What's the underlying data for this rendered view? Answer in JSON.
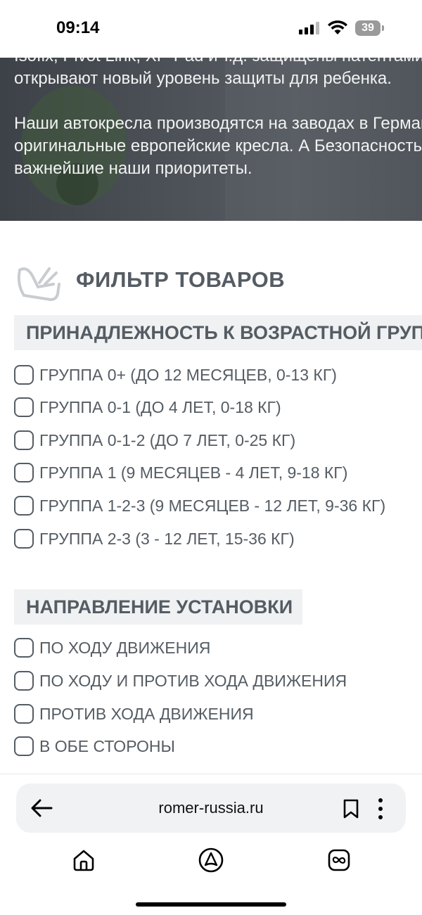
{
  "status_bar": {
    "time": "09:14",
    "battery": "39"
  },
  "hero": {
    "lines": [
      "Isofix, Pivot Link, XP-Pad и т.д. защищены патентами",
      "открывают новый уровень защиты для ребенка.",
      "",
      "Наши автокресла производятся на заводах в Германии",
      "оригинальные европейские кресла. А Безопасность",
      "важнейшие наши приоритеты."
    ]
  },
  "filter": {
    "title": "ФИЛЬТР ТОВАРОВ",
    "groups": [
      {
        "heading": "ПРИНАДЛЕЖНОСТЬ К ВОЗРАСТНОЙ ГРУППЕ",
        "options": [
          "ГРУППА 0+ (ДО 12 МЕСЯЦЕВ, 0-13 КГ)",
          "ГРУППА 0-1 (ДО 4 ЛЕТ, 0-18 КГ)",
          "ГРУППА 0-1-2 (ДО 7 ЛЕТ, 0-25 КГ)",
          "ГРУППА 1 (9 МЕСЯЦЕВ - 4 ЛЕТ, 9-18 КГ)",
          "ГРУППА 1-2-3 (9 МЕСЯЦЕВ - 12 ЛЕТ, 9-36 КГ)",
          "ГРУППА 2-3 (3 - 12 ЛЕТ, 15-36 КГ)"
        ]
      },
      {
        "heading": "НАПРАВЛЕНИЕ УСТАНОВКИ",
        "options": [
          "ПО ХОДУ ДВИЖЕНИЯ",
          "ПО ХОДУ И ПРОТИВ ХОДА ДВИЖЕНИЯ",
          "ПРОТИВ ХОДА ДВИЖЕНИЯ",
          "В ОБЕ СТОРОНЫ"
        ]
      }
    ]
  },
  "browser": {
    "url": "romer-russia.ru"
  },
  "icons": {
    "back": "arrow-left-icon",
    "bookmark": "bookmark-icon",
    "more": "more-vertical-icon",
    "home": "home-icon",
    "assistant": "alice-icon",
    "tabs": "tabs-icon"
  }
}
